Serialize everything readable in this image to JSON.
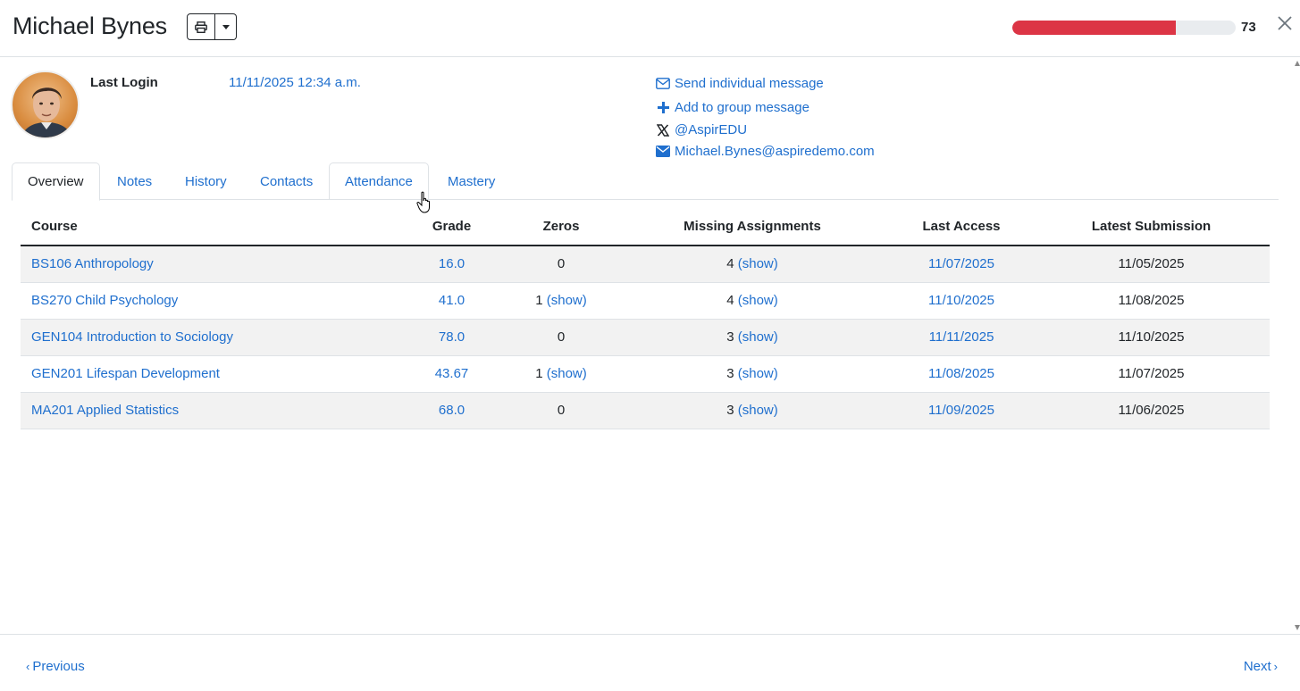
{
  "header": {
    "student_name": "Michael Bynes",
    "score": "73",
    "score_fraction": 0.73,
    "progress_color": "#dc3545"
  },
  "icons": {
    "print": "printer-icon",
    "dropdown": "caret-down-icon",
    "close": "close-icon",
    "email": "envelope-icon",
    "plus": "plus-icon",
    "x_social": "x-logo-icon"
  },
  "profile": {
    "login_label": "Last Login",
    "login_value": "11/11/2025 12:34 a.m."
  },
  "contacts": {
    "send_individual": "Send individual message",
    "add_group": "Add to group message",
    "social_handle": "@AspirEDU",
    "email": "Michael.Bynes@aspiredemo.com"
  },
  "tabs": [
    "Overview",
    "Notes",
    "History",
    "Contacts",
    "Attendance",
    "Mastery"
  ],
  "table": {
    "headers": [
      "Course",
      "Grade",
      "Zeros",
      "Missing Assignments",
      "Last Access",
      "Latest Submission"
    ],
    "rows": [
      {
        "course": "BS106 Anthropology",
        "grade": "16.0",
        "zeros": "0",
        "zeros_show": "",
        "missing": "4",
        "missing_show": "(show)",
        "last_access": "11/07/2025",
        "latest_submission": "11/05/2025"
      },
      {
        "course": "BS270 Child Psychology",
        "grade": "41.0",
        "zeros": "1",
        "zeros_show": "(show)",
        "missing": "4",
        "missing_show": "(show)",
        "last_access": "11/10/2025",
        "latest_submission": "11/08/2025"
      },
      {
        "course": "GEN104 Introduction to Sociology",
        "grade": "78.0",
        "zeros": "0",
        "zeros_show": "",
        "missing": "3",
        "missing_show": "(show)",
        "last_access": "11/11/2025",
        "latest_submission": "11/10/2025"
      },
      {
        "course": "GEN201 Lifespan Development",
        "grade": "43.67",
        "zeros": "1",
        "zeros_show": "(show)",
        "missing": "3",
        "missing_show": "(show)",
        "last_access": "11/08/2025",
        "latest_submission": "11/07/2025"
      },
      {
        "course": "MA201 Applied Statistics",
        "grade": "68.0",
        "zeros": "0",
        "zeros_show": "",
        "missing": "3",
        "missing_show": "(show)",
        "last_access": "11/09/2025",
        "latest_submission": "11/06/2025"
      }
    ]
  },
  "footer": {
    "previous": "Previous",
    "next": "Next"
  }
}
